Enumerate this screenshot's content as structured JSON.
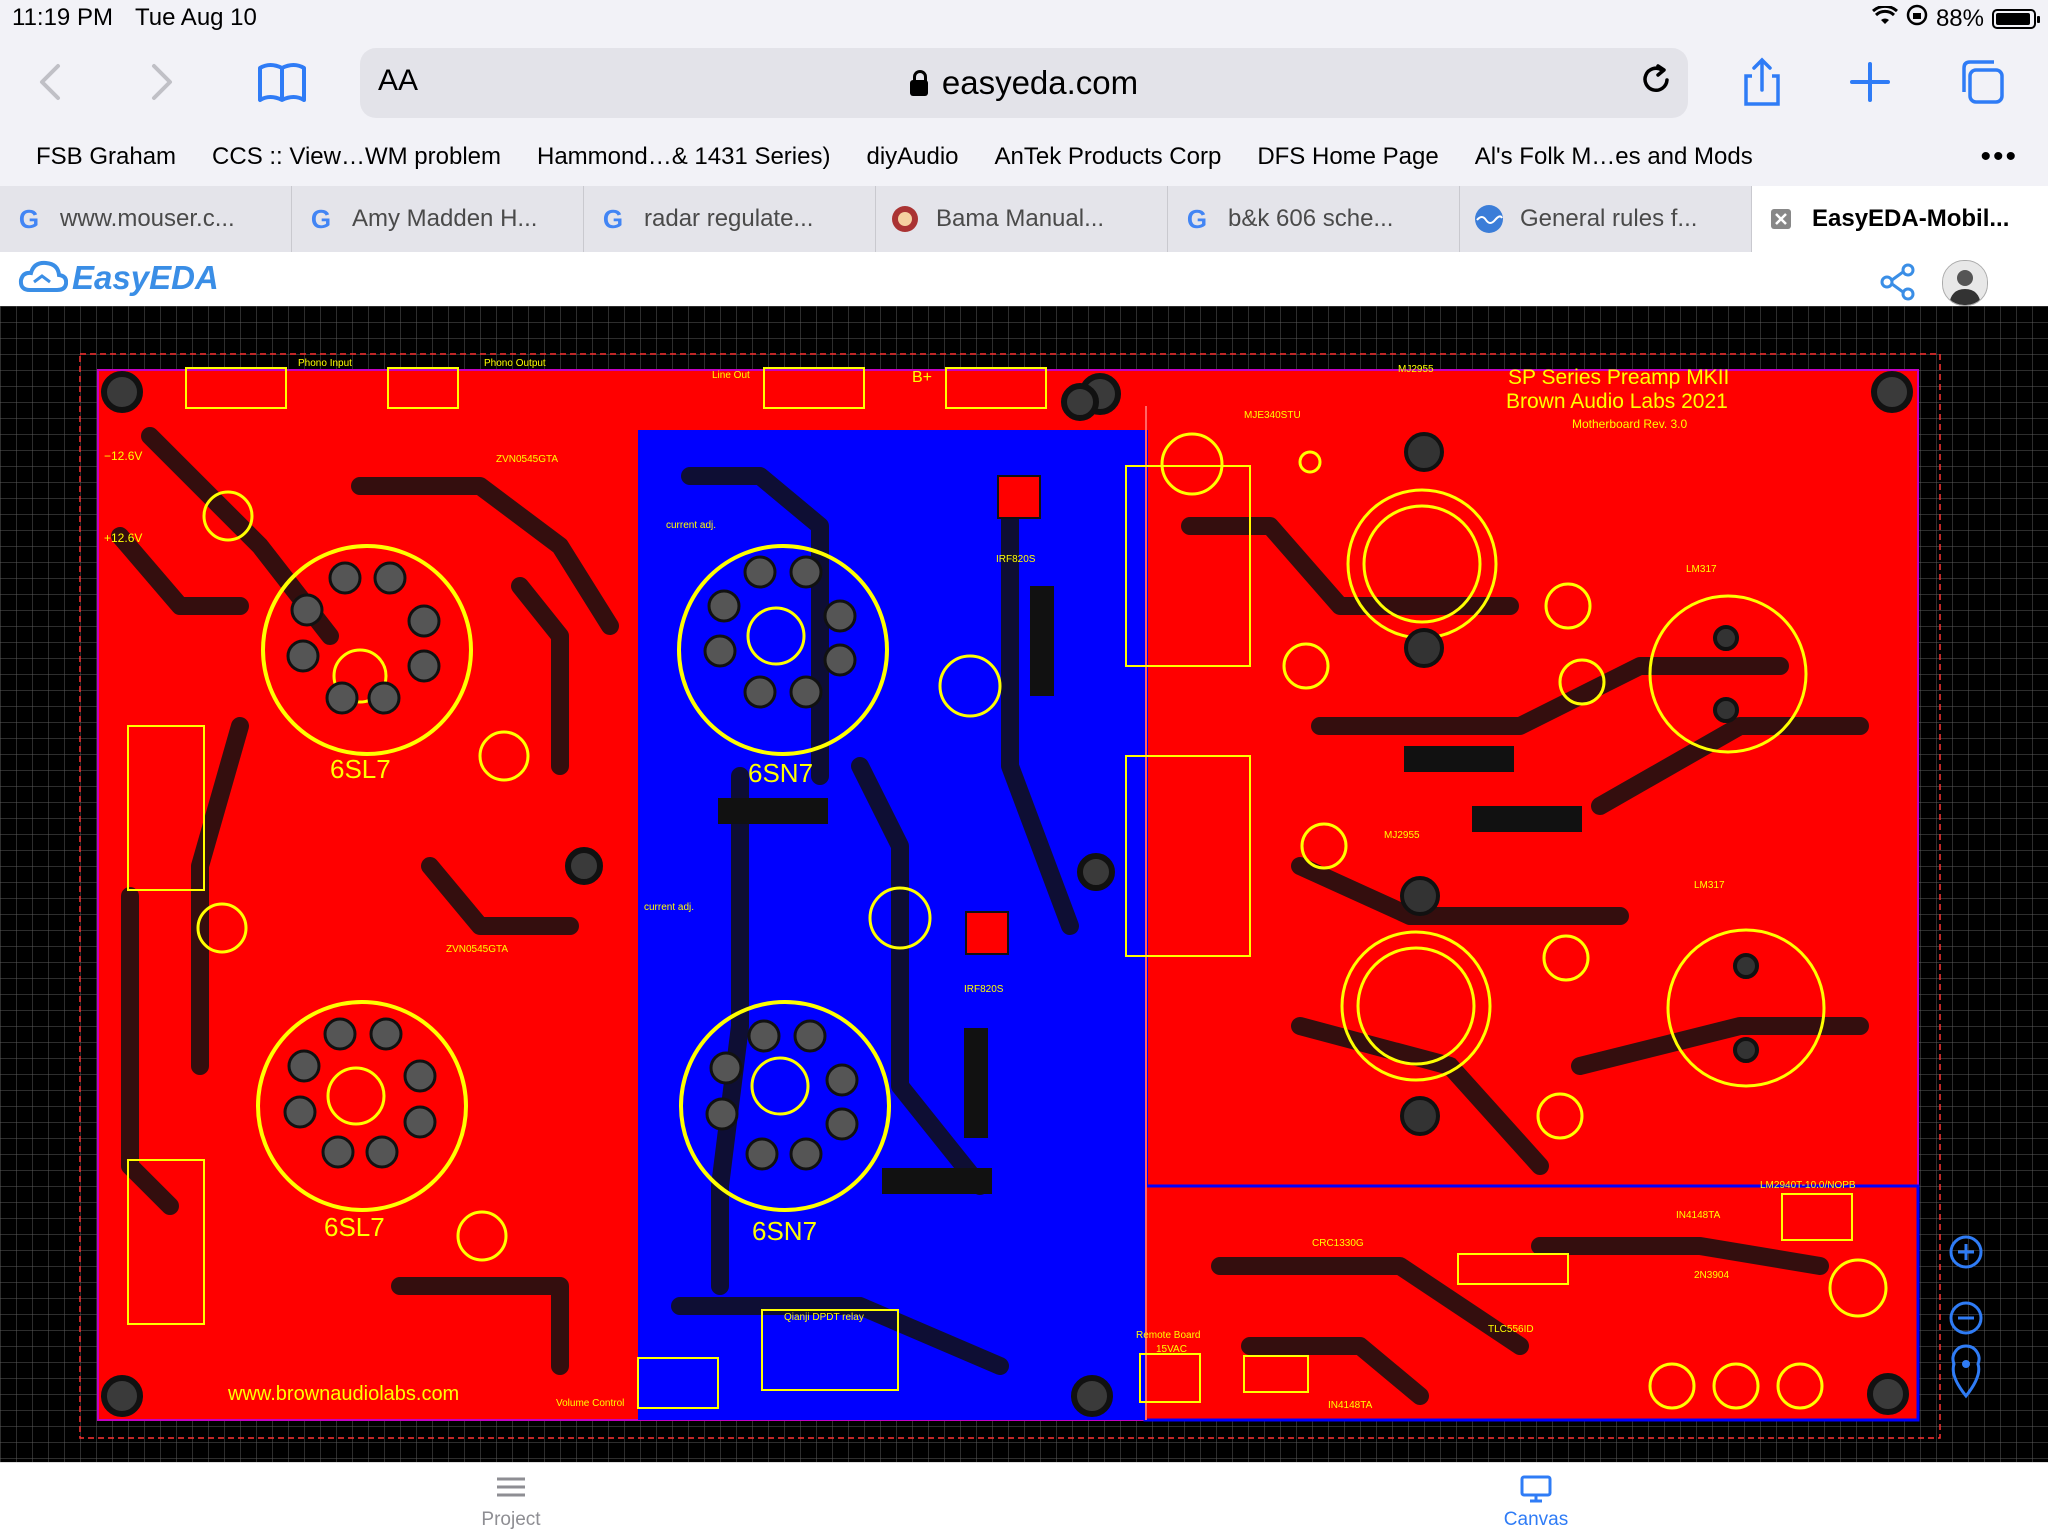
{
  "status": {
    "time": "11:19 PM",
    "date": "Tue Aug 10",
    "battery": "88%"
  },
  "browser": {
    "url": "easyeda.com",
    "text_size_label": "AA",
    "bookmarks": [
      "FSB Graham",
      "CCS :: View…WM problem",
      "Hammond…& 1431 Series)",
      "diyAudio",
      "AnTek Products Corp",
      "DFS Home Page",
      "Al's Folk M…es and Mods"
    ],
    "tabs": [
      {
        "label": "www.mouser.c...",
        "icon": "google-icon"
      },
      {
        "label": "Amy Madden H...",
        "icon": "google-icon"
      },
      {
        "label": "radar regulate...",
        "icon": "google-icon"
      },
      {
        "label": "Bama Manual...",
        "icon": "bama-icon"
      },
      {
        "label": "b&k 606 sche...",
        "icon": "google-icon"
      },
      {
        "label": "General rules f...",
        "icon": "wave-icon"
      },
      {
        "label": "EasyEDA-Mobil...",
        "icon": "close-icon",
        "active": true
      }
    ]
  },
  "app": {
    "logo_text": "EasyEDA"
  },
  "pcb": {
    "title_lines": [
      "SP Series Preamp MKII",
      "Brown Audio Labs 2021"
    ],
    "subtitle": "Motherboard Rev. 3.0",
    "website": "www.brownaudiolabs.com",
    "tubes": [
      "6SL7",
      "6SL7",
      "6SN7",
      "6SN7"
    ],
    "labels": {
      "phono_input": "Phono Input",
      "phono_output": "Phono Output",
      "line_out": "Line Out",
      "bplus": "B+",
      "neg12": "−12.6V",
      "pos12": "+12.6V",
      "mj1": "MJ2955",
      "mj2": "MJ2955",
      "mje": "MJE340STU",
      "lm317a": "LM317",
      "lm317b": "LM317",
      "irf1": "IRF820S",
      "irf2": "IRF820S",
      "zvn1": "ZVN0545GTA",
      "zvn2": "ZVN0545GTA",
      "current1": "current adj.",
      "current2": "current adj.",
      "relay": "Qianji DPDT relay",
      "volume": "Volume Control",
      "remote": "Remote Board",
      "vac": "15VAC",
      "lm2940": "LM2940T-10.0/NOPB",
      "tlc": "TLC556ID",
      "crc": "CRC1330G",
      "diode1": "IN4148TA",
      "diode2": "IN4148TA",
      "q2n": "2N3904"
    }
  },
  "bottom_nav": {
    "project": "Project",
    "canvas": "Canvas"
  },
  "colors": {
    "accent": "#2f7cf6",
    "pcb_red": "#ff0000",
    "pcb_blue": "#0000ff",
    "silk": "#ffff00"
  }
}
